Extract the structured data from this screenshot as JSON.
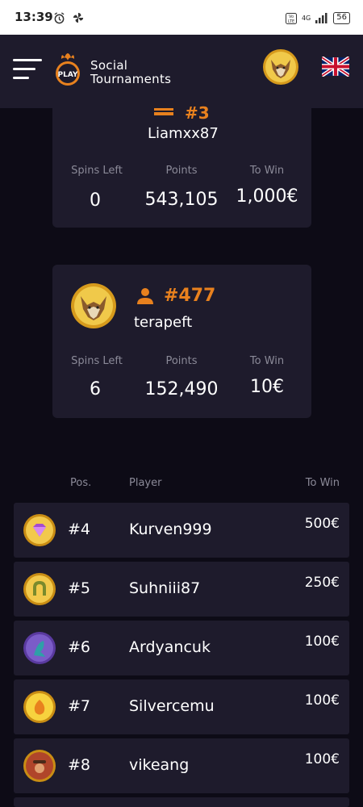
{
  "status_bar": {
    "time": "13:39",
    "network": "4G",
    "battery": "56"
  },
  "header": {
    "brand_line1": "Social",
    "brand_line2": "Tournaments",
    "logo_text": "PLAY",
    "accent_color": "#e8811e"
  },
  "top_card": {
    "rank": "#3",
    "player": "Liamxx87",
    "labels": {
      "spins_left": "Spins Left",
      "points": "Points",
      "to_win": "To Win"
    },
    "spins_left": "0",
    "points": "543,105",
    "to_win": "1,000€"
  },
  "my_card": {
    "rank": "#477",
    "player": "terapeft",
    "labels": {
      "spins_left": "Spins Left",
      "points": "Points",
      "to_win": "To Win"
    },
    "spins_left": "6",
    "points": "152,490",
    "to_win": "10€"
  },
  "table": {
    "headers": {
      "pos": "Pos.",
      "player": "Player",
      "to_win": "To Win"
    },
    "rows": [
      {
        "pos": "#4",
        "player": "Kurven999",
        "to_win": "500€",
        "avatar": "purple-gem-coin"
      },
      {
        "pos": "#5",
        "player": "Suhniii87",
        "to_win": "250€",
        "avatar": "horseshoe-coin"
      },
      {
        "pos": "#6",
        "player": "Ardyancuk",
        "to_win": "100€",
        "avatar": "sea-creature-coin"
      },
      {
        "pos": "#7",
        "player": "Silvercemu",
        "to_win": "100€",
        "avatar": "golden-fruit-coin"
      },
      {
        "pos": "#8",
        "player": "vikeang",
        "to_win": "100€",
        "avatar": "cowboy-coin"
      }
    ]
  }
}
